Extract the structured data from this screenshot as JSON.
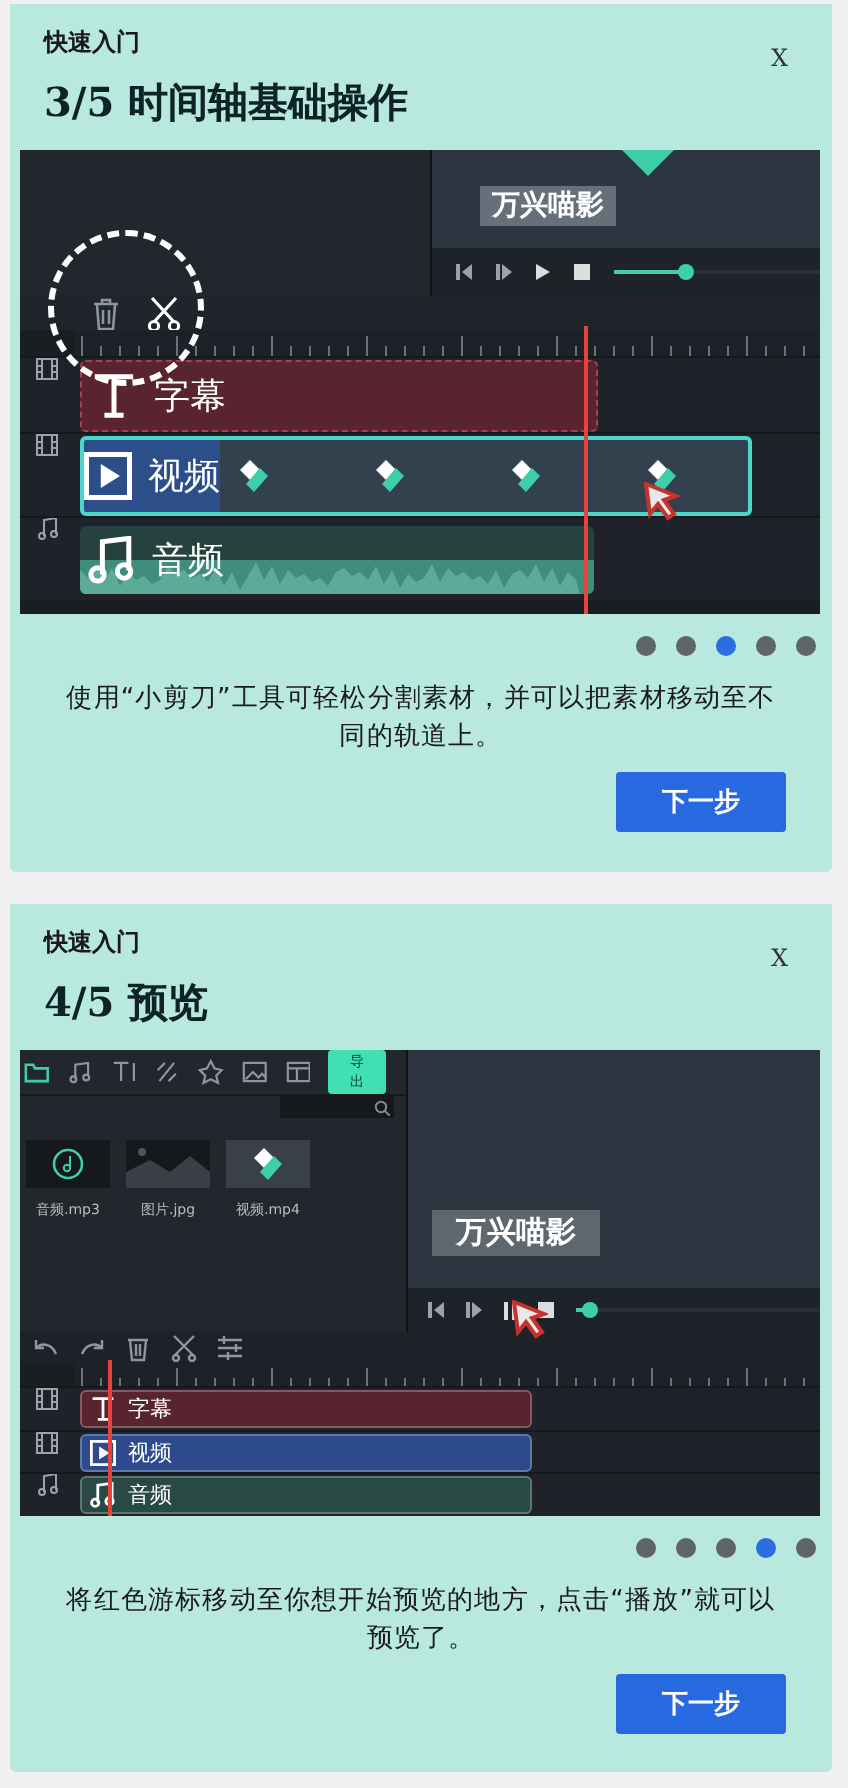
{
  "guides": [
    {
      "header": "快速入门",
      "close": "X",
      "title": "3/5 时间轴基础操作",
      "screenshot": {
        "kind": "timeline",
        "preview_caption": "万兴喵影",
        "tracks": [
          {
            "kind": "subtitle",
            "label": "字幕",
            "selected": false
          },
          {
            "kind": "video",
            "label": "视频",
            "selected": true
          },
          {
            "kind": "audio",
            "label": "音频",
            "selected": false
          }
        ]
      },
      "dots": [
        {
          "selected": false
        },
        {
          "selected": false
        },
        {
          "selected": true
        },
        {
          "selected": false
        },
        {
          "selected": false
        }
      ],
      "description": "使用“小剪刀”工具可轻松分割素材，并可以把素材移动至不同的轨道上。",
      "button": "下一步"
    },
    {
      "header": "快速入门",
      "close": "X",
      "title": "4/5 预览",
      "screenshot": {
        "kind": "preview",
        "preview_caption": "万兴喵影",
        "export_button": "导出",
        "media": [
          {
            "kind": "audio",
            "label": "音频.mp3"
          },
          {
            "kind": "image",
            "label": "图片.jpg"
          },
          {
            "kind": "video",
            "label": "视频.mp4"
          }
        ],
        "tracks": [
          {
            "kind": "subtitle",
            "label": "字幕",
            "selected": false
          },
          {
            "kind": "video",
            "label": "视频",
            "selected": false
          },
          {
            "kind": "audio",
            "label": "音频",
            "selected": false
          }
        ]
      },
      "dots": [
        {
          "selected": false
        },
        {
          "selected": false
        },
        {
          "selected": false
        },
        {
          "selected": true
        },
        {
          "selected": false
        }
      ],
      "description": "将红色游标移动至你想开始预览的地方，点击“播放”就可以预览了。",
      "button": "下一步"
    }
  ]
}
